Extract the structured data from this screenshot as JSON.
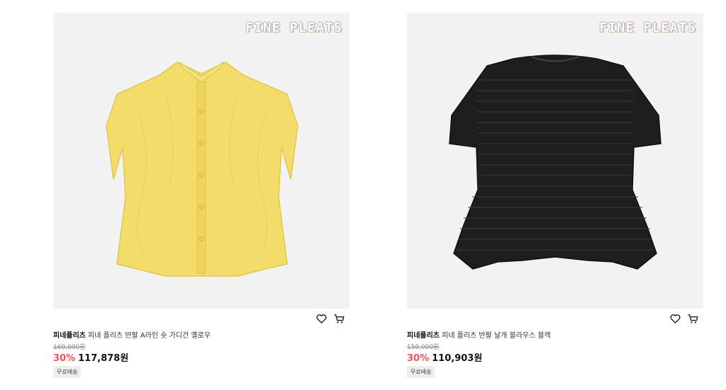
{
  "products": [
    {
      "brand_logo": "FINE PLEATS",
      "brand": "피네플리츠",
      "name": "피네 플리츠 반팔 A라인 숏 가디건 옐로우",
      "original_price": "169,000원",
      "discount": "30%",
      "price": "117,878원",
      "badge": "무료배송",
      "image": "yellow short-sleeve pleated cardigan"
    },
    {
      "brand_logo": "FINE PLEATS",
      "brand": "피네플리츠",
      "name": "피네 플리츠 반팔 날개 블라우스 블랙",
      "original_price": "159,000원",
      "discount": "30%",
      "price": "110,903원",
      "badge": "무료배송",
      "image": "black short-sleeve pleated blouse"
    }
  ],
  "icons": {
    "wishlist": "heart-icon",
    "cart": "cart-icon"
  },
  "colors": {
    "discount": "#f0525a",
    "image_bg": "#f3f2f2",
    "yellow": "#f4dc6a",
    "black": "#1e1e1e"
  }
}
